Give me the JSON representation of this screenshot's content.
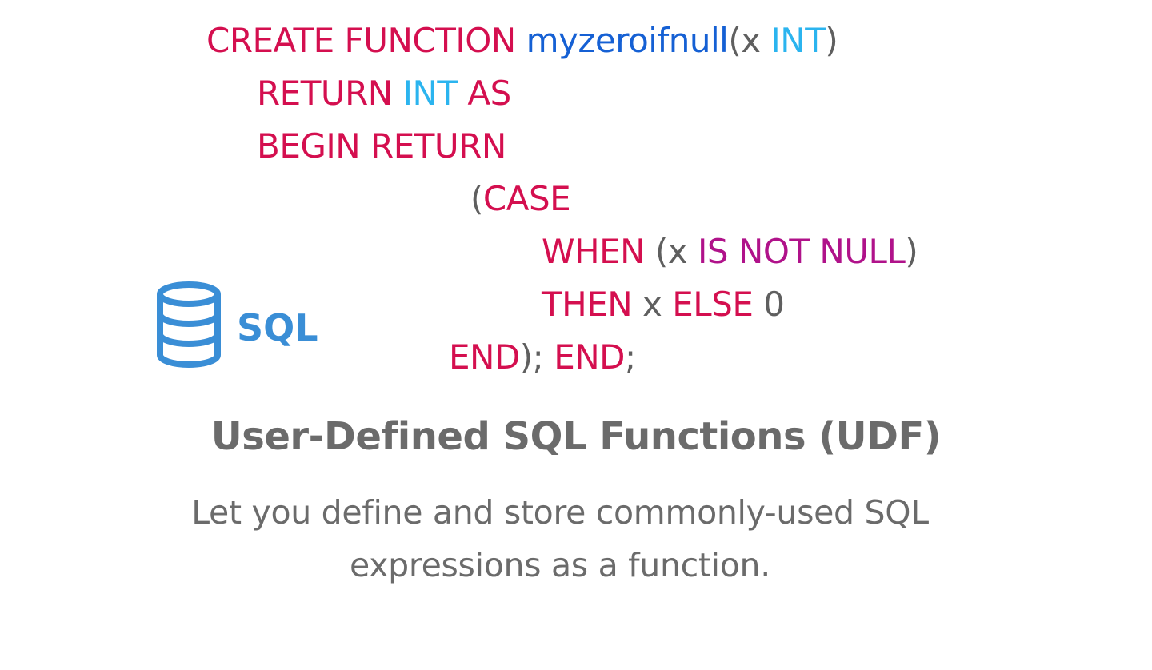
{
  "colors": {
    "keyword": "#d40f4f",
    "function_name": "#1560d4",
    "type": "#2bb4ef",
    "plain": "#5f5f5f",
    "operator": "#b0128a",
    "logo": "#3a8ed6",
    "title": "#6b6b6b",
    "subtitle": "#6b6b6b"
  },
  "code": {
    "line1": {
      "kw1": "CREATE FUNCTION ",
      "fn": "myzeroifnull",
      "p1": "(x ",
      "ty": "INT",
      "p2": ")"
    },
    "line2": {
      "kw1": "RETURN ",
      "ty": "INT",
      "kw2": " AS"
    },
    "line3": {
      "kw1": "BEGIN RETURN"
    },
    "line4": {
      "p1": "(",
      "kw1": "CASE"
    },
    "line5": {
      "kw1": "WHEN ",
      "p1": "(x ",
      "op": "IS NOT NULL",
      "p2": ")"
    },
    "line6": {
      "kw1": "THEN ",
      "p1": "x ",
      "kw2": "ELSE ",
      "p2": "0"
    },
    "line7": {
      "kw1": "END",
      "p1": "); ",
      "kw2": "END",
      "p2": ";"
    }
  },
  "logo": {
    "icon": "database-icon",
    "text": "SQL"
  },
  "headline": "User-Defined SQL Functions (UDF)",
  "description": {
    "line1": "Let you define and store commonly-used SQL",
    "line2": "expressions as a function."
  }
}
